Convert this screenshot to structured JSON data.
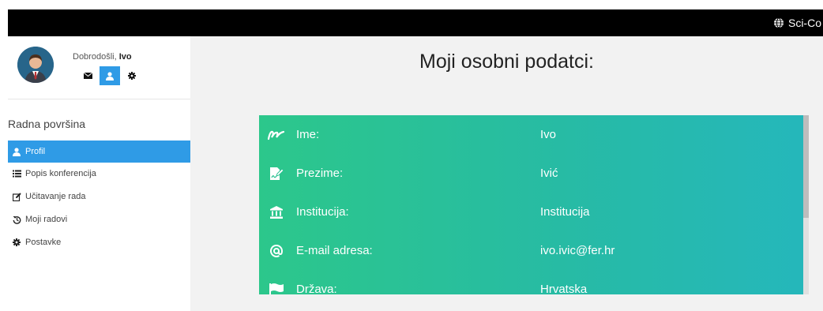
{
  "topbar": {
    "brand": "Sci-Co"
  },
  "user": {
    "greeting": "Dobrodošli,",
    "name": "Ivo"
  },
  "sidebar": {
    "section_title": "Radna površina",
    "items": [
      {
        "label": "Profil",
        "icon": "user-icon"
      },
      {
        "label": "Popis konferencija",
        "icon": "list-icon"
      },
      {
        "label": "Učitavanje rada",
        "icon": "edit-icon"
      },
      {
        "label": "Moji radovi",
        "icon": "history-icon"
      },
      {
        "label": "Postavke",
        "icon": "gear-icon"
      }
    ]
  },
  "main": {
    "title": "Moji osobni podatci:",
    "fields": [
      {
        "label": "Ime:",
        "value": "Ivo",
        "icon": "signature-icon"
      },
      {
        "label": "Prezime:",
        "value": "Ivić",
        "icon": "file-signature-icon"
      },
      {
        "label": "Institucija:",
        "value": "Institucija",
        "icon": "university-icon"
      },
      {
        "label": "E-mail adresa:",
        "value": "ivo.ivic@fer.hr",
        "icon": "at-icon"
      },
      {
        "label": "Država:",
        "value": "Hrvatska",
        "icon": "flag-icon"
      }
    ]
  },
  "colors": {
    "accent": "#2f9be6",
    "card_start": "#2cc78b",
    "card_end": "#25b7bb"
  }
}
